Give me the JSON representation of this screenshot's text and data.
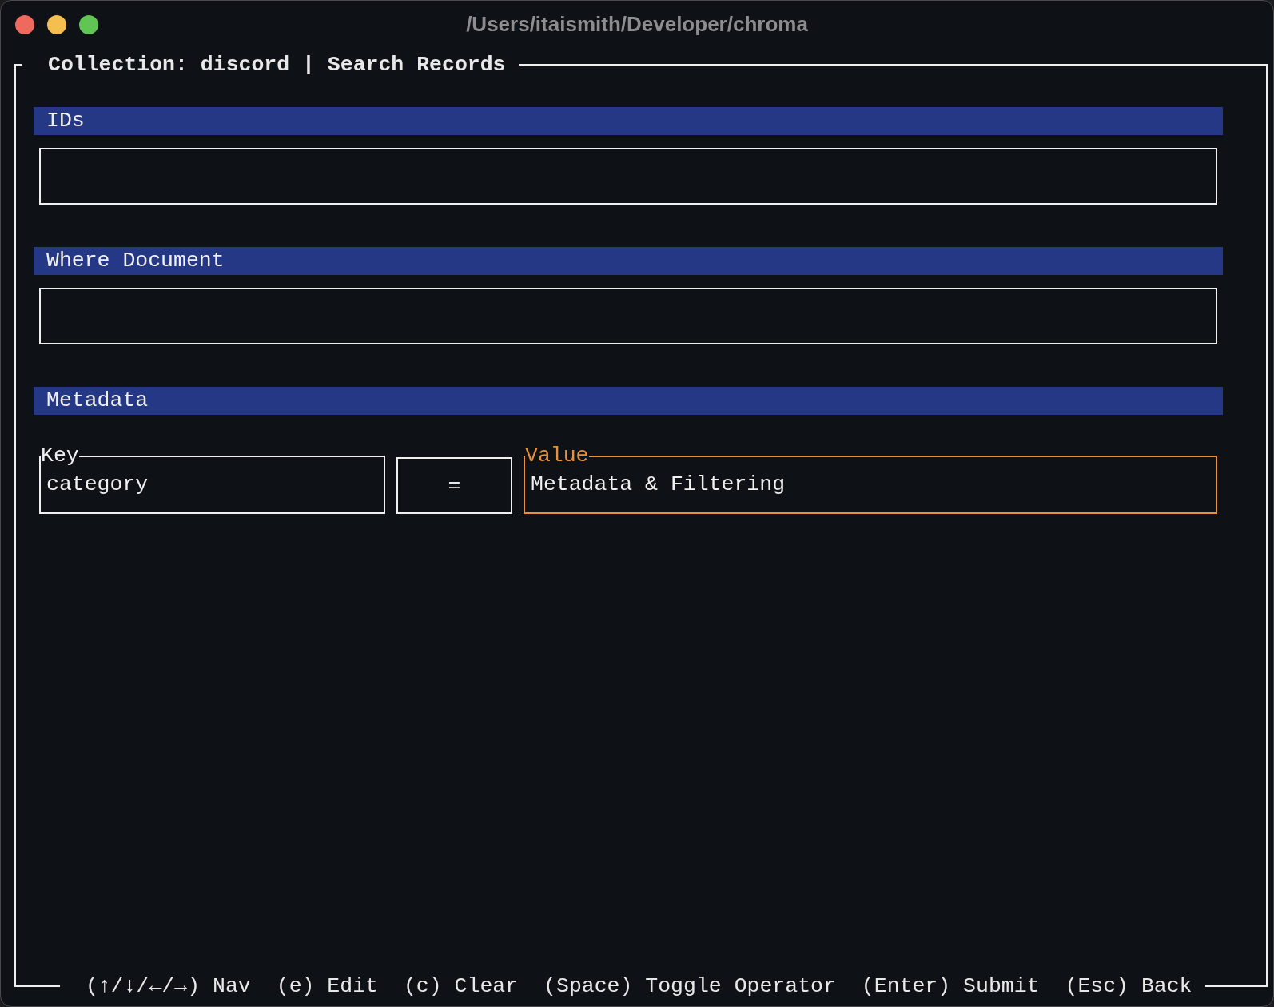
{
  "window": {
    "title": "/Users/itaismith/Developer/chroma"
  },
  "panel": {
    "title": "Collection: discord | Search Records"
  },
  "sections": [
    {
      "kind": "input",
      "label": "IDs"
    },
    {
      "kind": "input",
      "label": "Where Document"
    },
    {
      "kind": "filter",
      "label": "Metadata",
      "key": {
        "label": "Key",
        "value": "category",
        "focused": false
      },
      "operator": "=",
      "value": {
        "label": "Value",
        "value": "Metadata & Filtering",
        "focused": true
      }
    }
  ],
  "footer": {
    "hints": [
      "(↑/↓/←/→) Nav",
      "(e) Edit",
      "(c) Clear",
      "(Space) Toggle Operator",
      "(Enter) Submit",
      "(Esc) Back"
    ]
  }
}
